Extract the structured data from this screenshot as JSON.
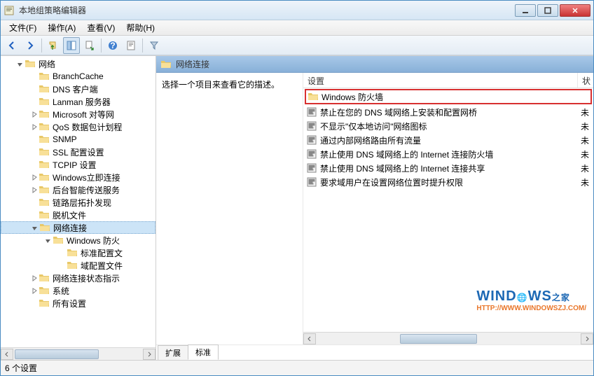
{
  "window": {
    "title": "本地组策略编辑器"
  },
  "menu": {
    "file": "文件(F)",
    "action": "操作(A)",
    "view": "查看(V)",
    "help": "帮助(H)"
  },
  "tree": {
    "root": "网络",
    "items": [
      "BranchCache",
      "DNS 客户端",
      "Lanman 服务器",
      "Microsoft 对等网",
      "QoS 数据包计划程",
      "SNMP",
      "SSL 配置设置",
      "TCPIP 设置",
      "Windows立即连接",
      "后台智能传送服务",
      "链路层拓扑发现",
      "脱机文件",
      "网络连接",
      "网络连接状态指示",
      "系统",
      "所有设置"
    ],
    "firewall": "Windows 防火",
    "firewall_children": [
      "标准配置文",
      "域配置文件"
    ]
  },
  "detail": {
    "header": "网络连接",
    "desc": "选择一个项目来查看它的描述。",
    "col_setting": "设置",
    "col_state": "状",
    "rows": [
      {
        "type": "folder",
        "label": "Windows 防火墙",
        "state": ""
      },
      {
        "type": "setting",
        "label": "禁止在您的 DNS 域网络上安装和配置网桥",
        "state": "未"
      },
      {
        "type": "setting",
        "label": "不显示\"仅本地访问\"网络图标",
        "state": "未"
      },
      {
        "type": "setting",
        "label": "通过内部网络路由所有流量",
        "state": "未"
      },
      {
        "type": "setting",
        "label": "禁止使用 DNS 域网络上的 Internet 连接防火墙",
        "state": "未"
      },
      {
        "type": "setting",
        "label": "禁止使用 DNS 域网络上的 Internet 连接共享",
        "state": "未"
      },
      {
        "type": "setting",
        "label": "要求域用户在设置网络位置时提升权限",
        "state": "未"
      }
    ],
    "tabs": {
      "extended": "扩展",
      "standard": "标准"
    }
  },
  "status": "6 个设置",
  "watermark": {
    "brand": "WINDOWS之家",
    "url": "HTTP://WWW.WINDOWSZJ.COM/"
  }
}
